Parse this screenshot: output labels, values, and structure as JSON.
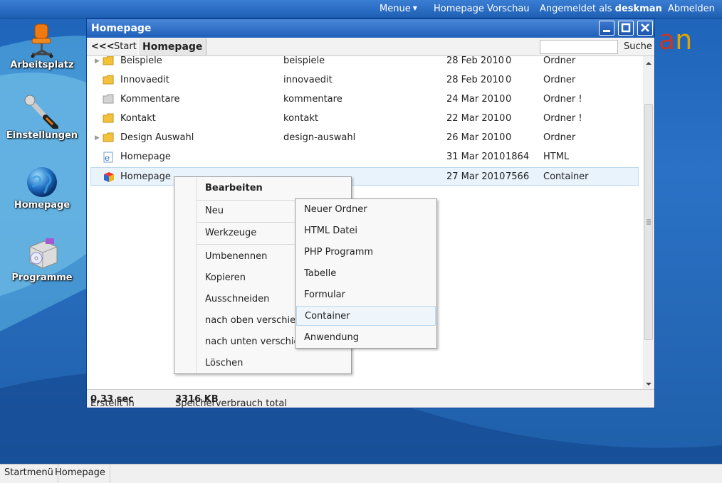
{
  "topbar": {
    "menu": "Menue",
    "preview": "Homepage Vorschau",
    "logged_in_prefix": "Angemeldet als",
    "user": "deskman",
    "logout": "Abmelden"
  },
  "desktop_icons": [
    {
      "label": "Arbeitsplatz",
      "icon": "office-chair-icon"
    },
    {
      "label": "Einstellungen",
      "icon": "wrench-icon"
    },
    {
      "label": "Homepage",
      "icon": "globe-icon"
    },
    {
      "label": "Programme",
      "icon": "software-box-icon"
    }
  ],
  "brand": {
    "a": "a",
    "n": "n",
    "c": "©"
  },
  "window": {
    "title": "Homepage",
    "back": "<<<",
    "start": "Start",
    "breadcrumb": "Homepage",
    "search_label": "Suche",
    "search_value": ""
  },
  "files": [
    {
      "name": "Beispiele",
      "alias": "beispiele",
      "date": "28 Feb 2010",
      "size": "0",
      "type": "Ordner",
      "icon": "folder-icon",
      "expandable": true
    },
    {
      "name": "Innovaedit",
      "alias": "innovaedit",
      "date": "28 Feb 2010",
      "size": "0",
      "type": "Ordner",
      "icon": "folder-icon",
      "expandable": false
    },
    {
      "name": "Kommentare",
      "alias": "kommentare",
      "date": "24 Mar 2010",
      "size": "0",
      "type": "Ordner !",
      "icon": "folder-gray-icon",
      "expandable": false
    },
    {
      "name": "Kontakt",
      "alias": "kontakt",
      "date": "22 Mar 2010",
      "size": "0",
      "type": "Ordner !",
      "icon": "folder-icon",
      "expandable": false
    },
    {
      "name": "Design Auswahl",
      "alias": "design-auswahl",
      "date": "26 Mar 2010",
      "size": "0",
      "type": "Ordner",
      "icon": "folder-icon",
      "expandable": true
    },
    {
      "name": "Homepage",
      "alias": "",
      "date": "31 Mar 2010",
      "size": "1864",
      "type": "HTML",
      "icon": "html-file-icon",
      "expandable": false
    },
    {
      "name": "Homepage",
      "alias": "",
      "date": "27 Mar 2010",
      "size": "7566",
      "type": "Container",
      "icon": "container-cube-icon",
      "expandable": false
    }
  ],
  "status": {
    "created_prefix": "Erstellt in",
    "created_value": "0,33 sec",
    "memory_prefix": "Speicherverbrauch total",
    "memory_value": "3316 KB"
  },
  "context_menu": [
    {
      "label": "Bearbeiten"
    },
    {
      "label": "Neu"
    },
    {
      "label": "Werkzeuge"
    },
    {
      "label": "Umbenennen"
    },
    {
      "label": "Kopieren"
    },
    {
      "label": "Ausschneiden"
    },
    {
      "label": "nach oben verschieben"
    },
    {
      "label": "nach unten verschieben"
    },
    {
      "label": "Löschen"
    }
  ],
  "submenu": [
    {
      "label": "Neuer Ordner"
    },
    {
      "label": "HTML Datei"
    },
    {
      "label": "PHP Programm"
    },
    {
      "label": "Tabelle"
    },
    {
      "label": "Formular"
    },
    {
      "label": "Container"
    },
    {
      "label": "Anwendung"
    }
  ],
  "taskbar": [
    {
      "label": "Startmenü"
    },
    {
      "label": "Homepage"
    }
  ]
}
